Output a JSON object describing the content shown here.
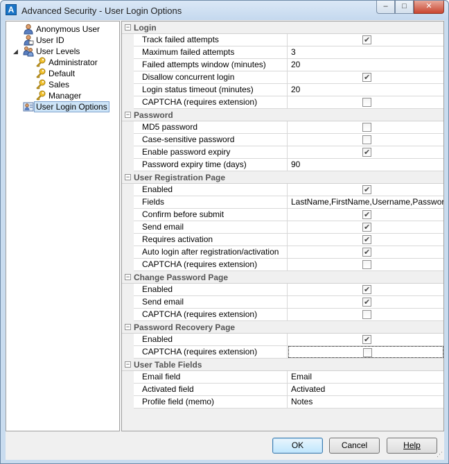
{
  "window": {
    "title": "Advanced Security - User Login Options",
    "app_icon": "A",
    "buttons": {
      "minimize": "–",
      "maximize": "□",
      "close": "✕"
    }
  },
  "tree": {
    "items": [
      {
        "label": "Anonymous User",
        "icon": "user-icon",
        "indent": 1
      },
      {
        "label": "User ID",
        "icon": "user-id-icon",
        "indent": 1
      },
      {
        "label": "User Levels",
        "icon": "user-levels-icon",
        "indent": 1,
        "expander": "◢"
      },
      {
        "label": "Administrator",
        "icon": "key-icon",
        "indent": 2
      },
      {
        "label": "Default",
        "icon": "key-icon",
        "indent": 2
      },
      {
        "label": "Sales",
        "icon": "key-icon",
        "indent": 2
      },
      {
        "label": "Manager",
        "icon": "key-icon",
        "indent": 2
      },
      {
        "label": "User Login Options",
        "icon": "login-options-icon",
        "indent": 1,
        "selected": true
      }
    ]
  },
  "grid": {
    "categories": [
      {
        "label": "Login",
        "toggle": "−",
        "rows": [
          {
            "name": "Track failed attempts",
            "type": "check",
            "checked": true
          },
          {
            "name": "Maximum failed attempts",
            "type": "text",
            "value": "3"
          },
          {
            "name": "Failed attempts window (minutes)",
            "type": "text",
            "value": "20"
          },
          {
            "name": "Disallow concurrent login",
            "type": "check",
            "checked": true
          },
          {
            "name": "Login status timeout (minutes)",
            "type": "text",
            "value": "20"
          },
          {
            "name": "CAPTCHA (requires extension)",
            "type": "check",
            "checked": false
          }
        ]
      },
      {
        "label": "Password",
        "toggle": "−",
        "rows": [
          {
            "name": "MD5 password",
            "type": "check",
            "checked": false
          },
          {
            "name": "Case-sensitive password",
            "type": "check",
            "checked": false
          },
          {
            "name": "Enable password expiry",
            "type": "check",
            "checked": true
          },
          {
            "name": "Password expiry time (days)",
            "type": "text",
            "value": "90"
          }
        ]
      },
      {
        "label": "User Registration Page",
        "toggle": "−",
        "rows": [
          {
            "name": "Enabled",
            "type": "check",
            "checked": true
          },
          {
            "name": "Fields",
            "type": "text",
            "value": "LastName,FirstName,Username,Password,Ema"
          },
          {
            "name": "Confirm before submit",
            "type": "check",
            "checked": true
          },
          {
            "name": "Send email",
            "type": "check",
            "checked": true
          },
          {
            "name": "Requires activation",
            "type": "check",
            "checked": true
          },
          {
            "name": "Auto login after registration/activation",
            "type": "check",
            "checked": true
          },
          {
            "name": "CAPTCHA (requires extension)",
            "type": "check",
            "checked": false
          }
        ]
      },
      {
        "label": "Change Password Page",
        "toggle": "−",
        "rows": [
          {
            "name": "Enabled",
            "type": "check",
            "checked": true
          },
          {
            "name": "Send email",
            "type": "check",
            "checked": true
          },
          {
            "name": "CAPTCHA (requires extension)",
            "type": "check",
            "checked": false
          }
        ]
      },
      {
        "label": "Password Recovery Page",
        "toggle": "−",
        "rows": [
          {
            "name": "Enabled",
            "type": "check",
            "checked": true
          },
          {
            "name": "CAPTCHA (requires extension)",
            "type": "check",
            "checked": false,
            "focused": true
          }
        ]
      },
      {
        "label": "User Table Fields",
        "toggle": "−",
        "rows": [
          {
            "name": "Email field",
            "type": "text",
            "value": "Email"
          },
          {
            "name": "Activated field",
            "type": "text",
            "value": "Activated"
          },
          {
            "name": "Profile field (memo)",
            "type": "text",
            "value": "Notes"
          }
        ]
      }
    ],
    "check_glyph": "✔"
  },
  "footer": {
    "ok_label": "OK",
    "cancel_label": "Cancel",
    "help_label": "Help"
  }
}
